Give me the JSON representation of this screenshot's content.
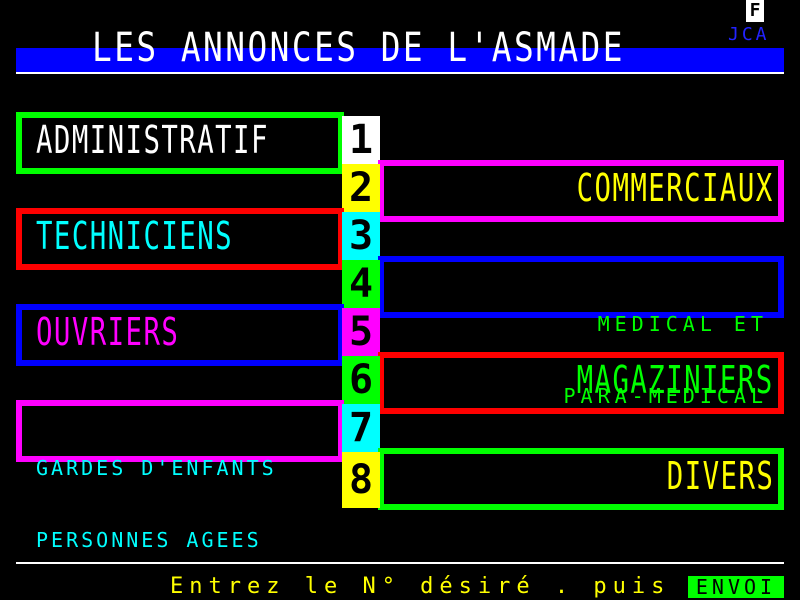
{
  "header": {
    "title": "LES ANNONCES DE L'ASMADE",
    "badge": "F",
    "publisher": "JCA"
  },
  "categories": [
    {
      "number": "1",
      "label": "ADMINISTRATIF",
      "color": "#00ff00",
      "text_color": "#ffffff",
      "number_bg": "#ffffff"
    },
    {
      "number": "2",
      "label": "COMMERCIAUX",
      "color": "#ff00ff",
      "text_color": "#ffff00",
      "number_bg": "#ffff00"
    },
    {
      "number": "3",
      "label": "TECHNICIENS",
      "color": "#ff0000",
      "text_color": "#00ffff",
      "number_bg": "#00ffff"
    },
    {
      "number": "4",
      "label_lines": [
        "MEDICAL ET",
        "PARA-MEDICAL"
      ],
      "color": "#0000ff",
      "text_color": "#00ff00",
      "number_bg": "#00ff00"
    },
    {
      "number": "5",
      "label": "OUVRIERS",
      "color": "#0000ff",
      "text_color": "#ff00ff",
      "number_bg": "#ff00ff"
    },
    {
      "number": "6",
      "label": "MAGAZINIERS",
      "color": "#ff0000",
      "text_color": "#00ff00",
      "number_bg": "#00ff00"
    },
    {
      "number": "7",
      "label_lines": [
        "GARDES D'ENFANTS",
        "PERSONNES AGEES"
      ],
      "color": "#ff00ff",
      "text_color": "#00ffff",
      "number_bg": "#00ffff"
    },
    {
      "number": "8",
      "label": "DIVERS",
      "color": "#00ff00",
      "text_color": "#ffff00",
      "number_bg": "#ffff00"
    }
  ],
  "footer": {
    "prompt": "Entrez le N° désiré . puis",
    "send_label": "ENVOI"
  }
}
